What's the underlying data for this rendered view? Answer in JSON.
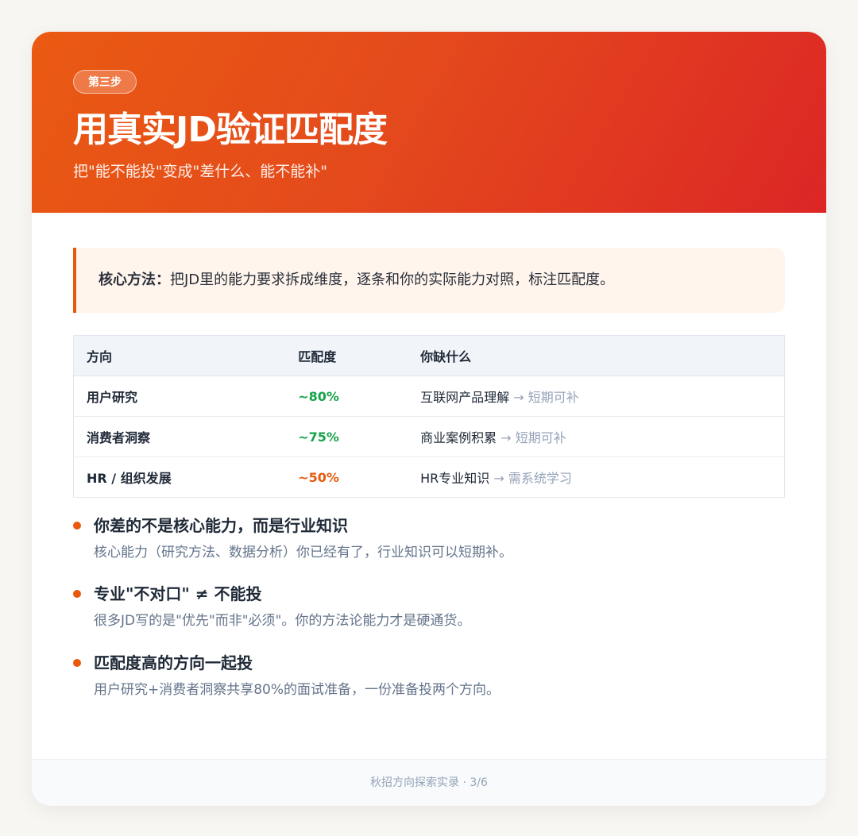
{
  "header": {
    "step_badge": "第三步",
    "title": "用真实JD验证匹配度",
    "subtitle": "把\"能不能投\"变成\"差什么、能不能补\""
  },
  "core_method": {
    "label": "核心方法：",
    "text": "把JD里的能力要求拆成维度，逐条和你的实际能力对照，标注匹配度。"
  },
  "table": {
    "headers": [
      "方向",
      "匹配度",
      "你缺什么"
    ],
    "rows": [
      {
        "direction": "用户研究",
        "match": "~80%",
        "gap": "互联网产品理解",
        "arrow": "→",
        "fix": "短期可补"
      },
      {
        "direction": "消费者洞察",
        "match": "~75%",
        "gap": "商业案例积累",
        "arrow": "→",
        "fix": "短期可补"
      },
      {
        "direction": "HR / 组织发展",
        "match": "~50%",
        "gap": "HR专业知识",
        "arrow": "→",
        "fix": "需系统学习"
      }
    ]
  },
  "points": [
    {
      "title": "你差的不是核心能力，而是行业知识",
      "desc": "核心能力（研究方法、数据分析）你已经有了，行业知识可以短期补。"
    },
    {
      "title": "专业\"不对口\" ≠ 不能投",
      "desc": "很多JD写的是\"优先\"而非\"必须\"。你的方法论能力才是硬通货。"
    },
    {
      "title": "匹配度高的方向一起投",
      "desc": "用户研究+消费者洞察共享80%的面试准备，一份准备投两个方向。"
    }
  ],
  "footer": {
    "text": "秋招方向探索实录 · 3/6"
  },
  "colors": {
    "accent": "#e8590c",
    "header_gradient_start": "#ea5a12",
    "header_gradient_end": "#dc2626",
    "match_high": "#16a34a",
    "match_mid": "#e8590c"
  }
}
